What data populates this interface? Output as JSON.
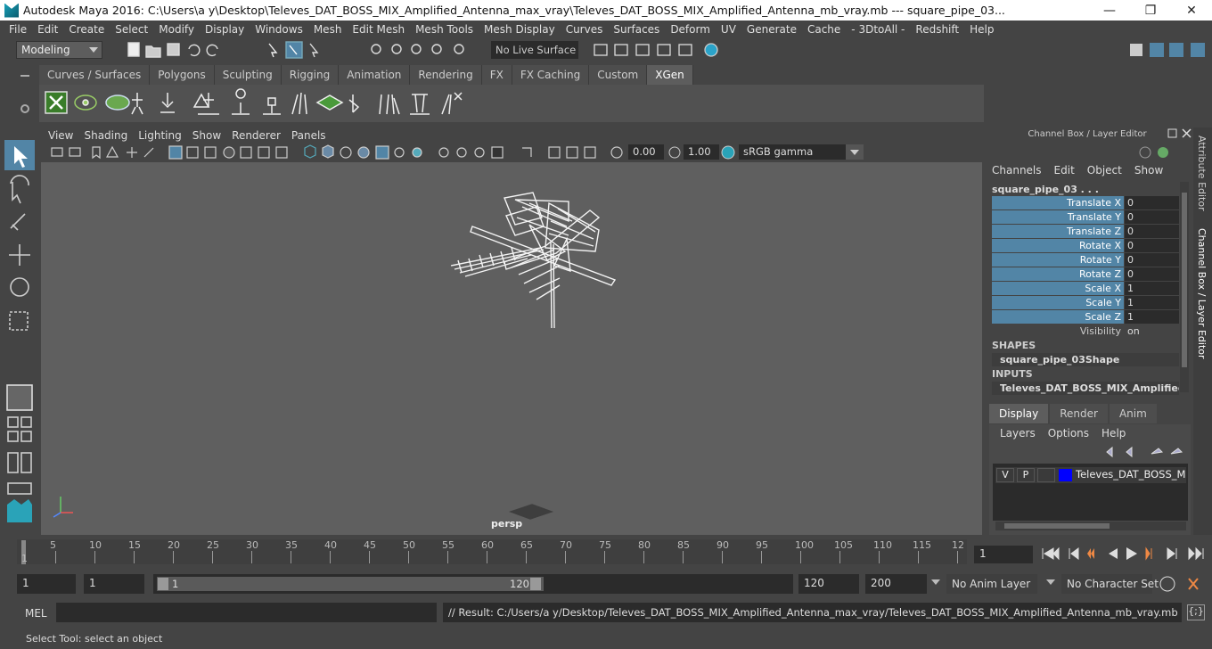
{
  "window": {
    "title": "Autodesk Maya 2016: C:\\Users\\a y\\Desktop\\Televes_DAT_BOSS_MIX_Amplified_Antenna_max_vray\\Televes_DAT_BOSS_MIX_Amplified_Antenna_mb_vray.mb    ---    square_pipe_03...",
    "minimize": "—",
    "maximize": "❐",
    "close": "✕"
  },
  "menus": [
    "File",
    "Edit",
    "Create",
    "Select",
    "Modify",
    "Display",
    "Windows",
    "Mesh",
    "Edit Mesh",
    "Mesh Tools",
    "Mesh Display",
    "Curves",
    "Surfaces",
    "Deform",
    "UV",
    "Generate",
    "Cache",
    "- 3DtoAll -",
    "Redshift",
    "Help"
  ],
  "status_line": {
    "mode": "Modeling",
    "live_surface": "No Live Surface"
  },
  "shelf": {
    "tabs": [
      "Curves / Surfaces",
      "Polygons",
      "Sculpting",
      "Rigging",
      "Animation",
      "Rendering",
      "FX",
      "FX Caching",
      "Custom",
      "XGen"
    ],
    "active_tab": "XGen"
  },
  "viewport": {
    "menus": [
      "View",
      "Shading",
      "Lighting",
      "Show",
      "Renderer",
      "Panels"
    ],
    "exposure": "0.00",
    "gamma": "1.00",
    "color_management": "sRGB gamma",
    "camera_label": "persp"
  },
  "channel_box": {
    "title": "Channel Box / Layer Editor",
    "menus": [
      "Channels",
      "Edit",
      "Object",
      "Show"
    ],
    "object_name": "square_pipe_03 . . .",
    "attributes": [
      {
        "label": "Translate X",
        "value": "0"
      },
      {
        "label": "Translate Y",
        "value": "0"
      },
      {
        "label": "Translate Z",
        "value": "0"
      },
      {
        "label": "Rotate X",
        "value": "0"
      },
      {
        "label": "Rotate Y",
        "value": "0"
      },
      {
        "label": "Rotate Z",
        "value": "0"
      },
      {
        "label": "Scale X",
        "value": "1"
      },
      {
        "label": "Scale Y",
        "value": "1"
      },
      {
        "label": "Scale Z",
        "value": "1"
      },
      {
        "label": "Visibility",
        "value": "on"
      }
    ],
    "shapes_header": "SHAPES",
    "shape_name": "square_pipe_03Shape",
    "inputs_header": "INPUTS",
    "input_name": "Televes_DAT_BOSS_MIX_Amplified_..."
  },
  "side_tabs": {
    "attribute_editor": "Attribute Editor",
    "channel_box": "Channel Box / Layer Editor"
  },
  "layer_editor": {
    "tabs": [
      "Display",
      "Render",
      "Anim"
    ],
    "active_tab": "Display",
    "menus": [
      "Layers",
      "Options",
      "Help"
    ],
    "layer": {
      "visible": "V",
      "playback": "P",
      "name": "Televes_DAT_BOSS_MIX_A",
      "color": "#0000ff"
    }
  },
  "time_slider": {
    "ticks": [
      "5",
      "10",
      "15",
      "20",
      "25",
      "30",
      "35",
      "40",
      "45",
      "50",
      "55",
      "60",
      "65",
      "70",
      "75",
      "80",
      "85",
      "90",
      "95",
      "100",
      "105",
      "110",
      "115",
      "12"
    ],
    "current_marker": "1",
    "current_frame": "1"
  },
  "range_slider": {
    "start_time": "1",
    "playback_start": "1",
    "range_start": "1",
    "range_end": "120",
    "playback_end": "120",
    "end_time": "200",
    "anim_layer": "No Anim Layer",
    "character_set": "No Character Set"
  },
  "command_line": {
    "label": "MEL",
    "result": "// Result: C:/Users/a y/Desktop/Televes_DAT_BOSS_MIX_Amplified_Antenna_max_vray/Televes_DAT_BOSS_MIX_Amplified_Antenna_mb_vray.mb"
  },
  "help_line": "Select Tool: select an object"
}
